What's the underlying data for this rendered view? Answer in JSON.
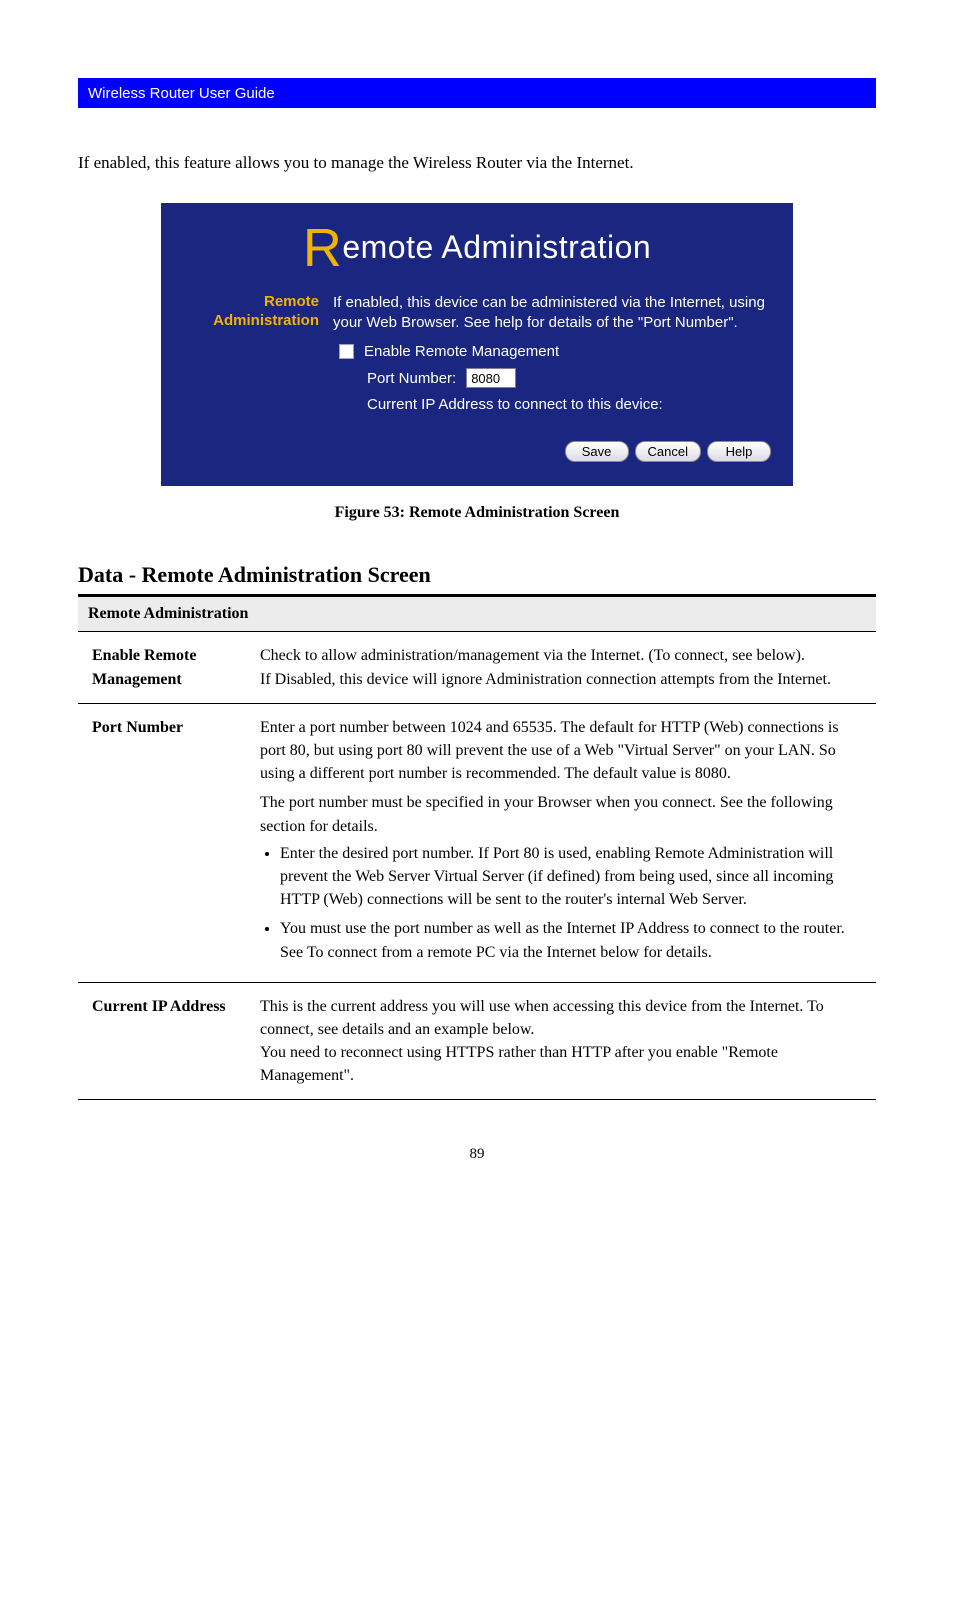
{
  "chapter": {
    "title": "Wireless Router User Guide",
    "right": ""
  },
  "intro": "If enabled, this feature allows you to manage the Wireless Router via the Internet.",
  "panel": {
    "title_rest": "emote Administration",
    "left_line1": "Remote",
    "left_line2": "Administration",
    "desc": "If enabled, this device can be administered via the Internet, using your Web Browser. See help for details of the \"Port Number\".",
    "enable_label": "Enable Remote Management",
    "port_label": "Port Number:",
    "port_value": "8080",
    "ip_line": "Current IP Address to connect to this device:",
    "btn_save": "Save",
    "btn_cancel": "Cancel",
    "btn_help": "Help"
  },
  "figure_caption": "Figure 53: Remote Administration Screen",
  "data_heading": "Data - Remote Administration Screen",
  "table": {
    "section": "Remote Administration",
    "rows": [
      {
        "label": "Enable Remote Management",
        "body": "Check to allow administration/management via the Internet. (To connect, see below).\nIf Disabled, this device will ignore Administration connection attempts from the Internet."
      },
      {
        "label": "Port Number",
        "lead": "Enter a port number between 1024 and 65535. The default for HTTP (Web) connections is port 80, but using port 80 will prevent the use of a Web \"Virtual Server\" on your LAN. So using a different port number is recommended. The default value is 8080.",
        "mid": "The port number must be specified in your Browser when you connect. See the following section for details.",
        "bullets_intro": "Enter the desired port number. If Port 80 is used, enabling Remote Administration will prevent the Web Server Virtual Server (if defined) from being used, since all incoming HTTP (Web) connections will be sent to the router's internal Web Server.",
        "bullets": [
          "You must use the port number as well as the Internet IP Address to connect to the router. See To connect from a remote PC via the Internet below for details."
        ]
      },
      {
        "label": "Current IP Address",
        "body": "This is the current address you will use when accessing this device from the Internet. To connect, see details and an example below.\nYou need to reconnect using HTTPS rather than HTTP after you enable \"Remote Management\"."
      }
    ]
  },
  "page_number": "89"
}
